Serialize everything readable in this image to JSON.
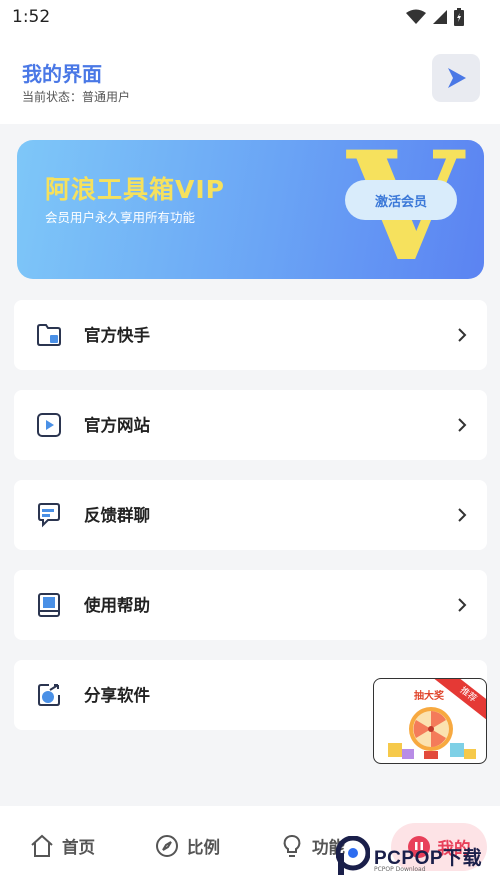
{
  "status_bar": {
    "time": "1:52"
  },
  "header": {
    "title": "我的界面",
    "status": "当前状态：普通用户"
  },
  "vip": {
    "title": "阿浪工具箱VIP",
    "subtitle": "会员用户永久享用所有功能",
    "activate_label": "激活会员",
    "letter": "V"
  },
  "menu": [
    {
      "label": "官方快手",
      "icon": "folder-icon"
    },
    {
      "label": "官方网站",
      "icon": "video-play-icon"
    },
    {
      "label": "反馈群聊",
      "icon": "chat-icon"
    },
    {
      "label": "使用帮助",
      "icon": "book-icon"
    },
    {
      "label": "分享软件",
      "icon": "share-icon"
    }
  ],
  "promo": {
    "title": "抽大奖",
    "ribbon": "推荐"
  },
  "bottom_nav": [
    {
      "label": "首页",
      "icon": "home-icon"
    },
    {
      "label": "比例",
      "icon": "compass-icon"
    },
    {
      "label": "功能",
      "icon": "lightbulb-icon"
    },
    {
      "label": "我的",
      "icon": "user-icon"
    }
  ],
  "watermark": {
    "text": "PCPOP下载",
    "sub": "PCPOP Download"
  },
  "colors": {
    "accent": "#4a78e6",
    "vip_gold": "#f6e15d",
    "active_tab": "#e8405a"
  }
}
